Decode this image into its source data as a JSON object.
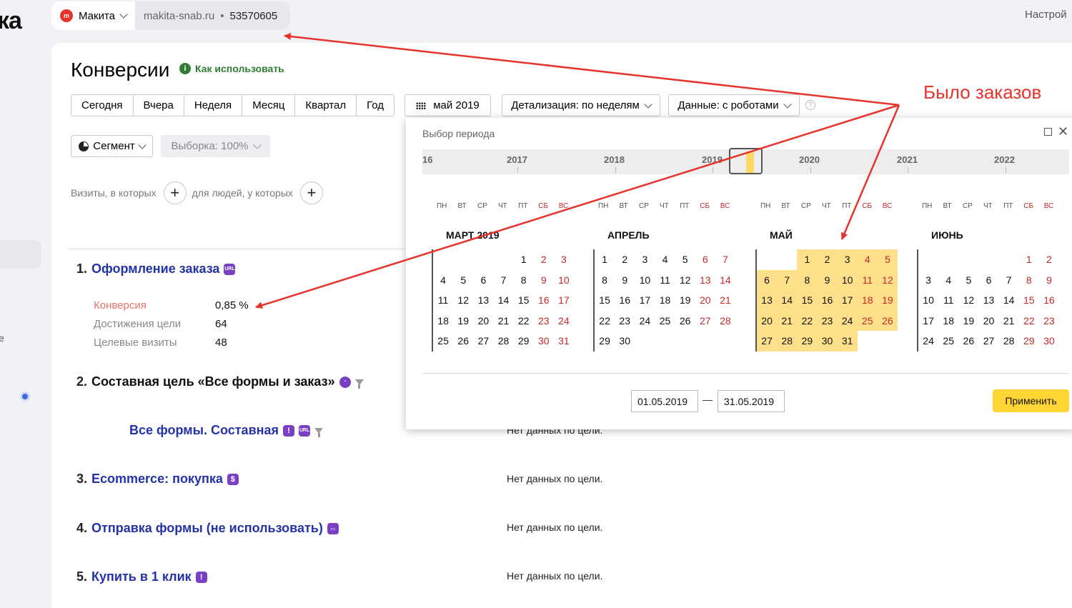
{
  "app": {
    "logo_fragment": "ка",
    "settings_label": "Настрой"
  },
  "counter": {
    "name": "Макита",
    "site": "makita-snab.ru",
    "separator": "•",
    "id": "53570605",
    "brand_mark": "m"
  },
  "page": {
    "title": "Конверсии",
    "how_to_label": "Как использовать"
  },
  "toolbar": {
    "periods": [
      "Сегодня",
      "Вчера",
      "Неделя",
      "Месяц",
      "Квартал",
      "Год"
    ],
    "date_label": "май 2019",
    "detail_label": "Детализация: по неделям",
    "data_label": "Данные: с роботами",
    "segment_label": "Сегмент",
    "sample_label": "Выборка: 100%"
  },
  "filters": {
    "visits_label": "Визиты, в которых",
    "people_label": "для людей, у которых"
  },
  "goals": [
    {
      "index": "1.",
      "name": "Оформление заказа",
      "badge": "URL"
    },
    {
      "index": "2.",
      "name": "Составная цель «Все формы и заказ»",
      "badge": ""
    },
    {
      "index": "",
      "name": "Все формы. Составная",
      "badge": "!",
      "badge2": "URL"
    },
    {
      "index": "3.",
      "name": "Ecommerce: покупка",
      "badge": "$"
    },
    {
      "index": "4.",
      "name": "Отправка формы (не использовать)",
      "badge": ""
    },
    {
      "index": "5.",
      "name": "Купить в 1 клик",
      "badge": "!"
    }
  ],
  "metrics": [
    {
      "label": "Конверсия",
      "value": "0,85 %"
    },
    {
      "label": "Достижения цели",
      "value": "64"
    },
    {
      "label": "Целевые визиты",
      "value": "48"
    }
  ],
  "nodata_text": "Нет данных по цели.",
  "calendar": {
    "title": "Выбор периода",
    "timeline_years": [
      "16",
      "2017",
      "2018",
      "2019",
      "2020",
      "2021",
      "2022"
    ],
    "weekdays": [
      "ПН",
      "ВТ",
      "СР",
      "ЧТ",
      "ПТ",
      "СБ",
      "ВС"
    ],
    "months": [
      {
        "name": "МАРТ 2019",
        "offset": 4,
        "days": 31
      },
      {
        "name": "АПРЕЛЬ",
        "offset": 0,
        "days": 30
      },
      {
        "name": "МАЙ",
        "offset": 2,
        "days": 31
      },
      {
        "name": "ИЮНЬ",
        "offset": 5,
        "days": 30
      }
    ],
    "selected_month_index": 2,
    "date_from": "01.05.2019",
    "date_to": "31.05.2019",
    "range_dash": "—",
    "apply_label": "Применить"
  },
  "annotation": {
    "text": "Было заказов",
    "color": "#e8322c"
  },
  "colors": {
    "link": "#2433a8",
    "accent_yellow": "#ffd633",
    "selection": "#ffe08a",
    "weekend": "#c62828",
    "green": "#2e7d32"
  }
}
